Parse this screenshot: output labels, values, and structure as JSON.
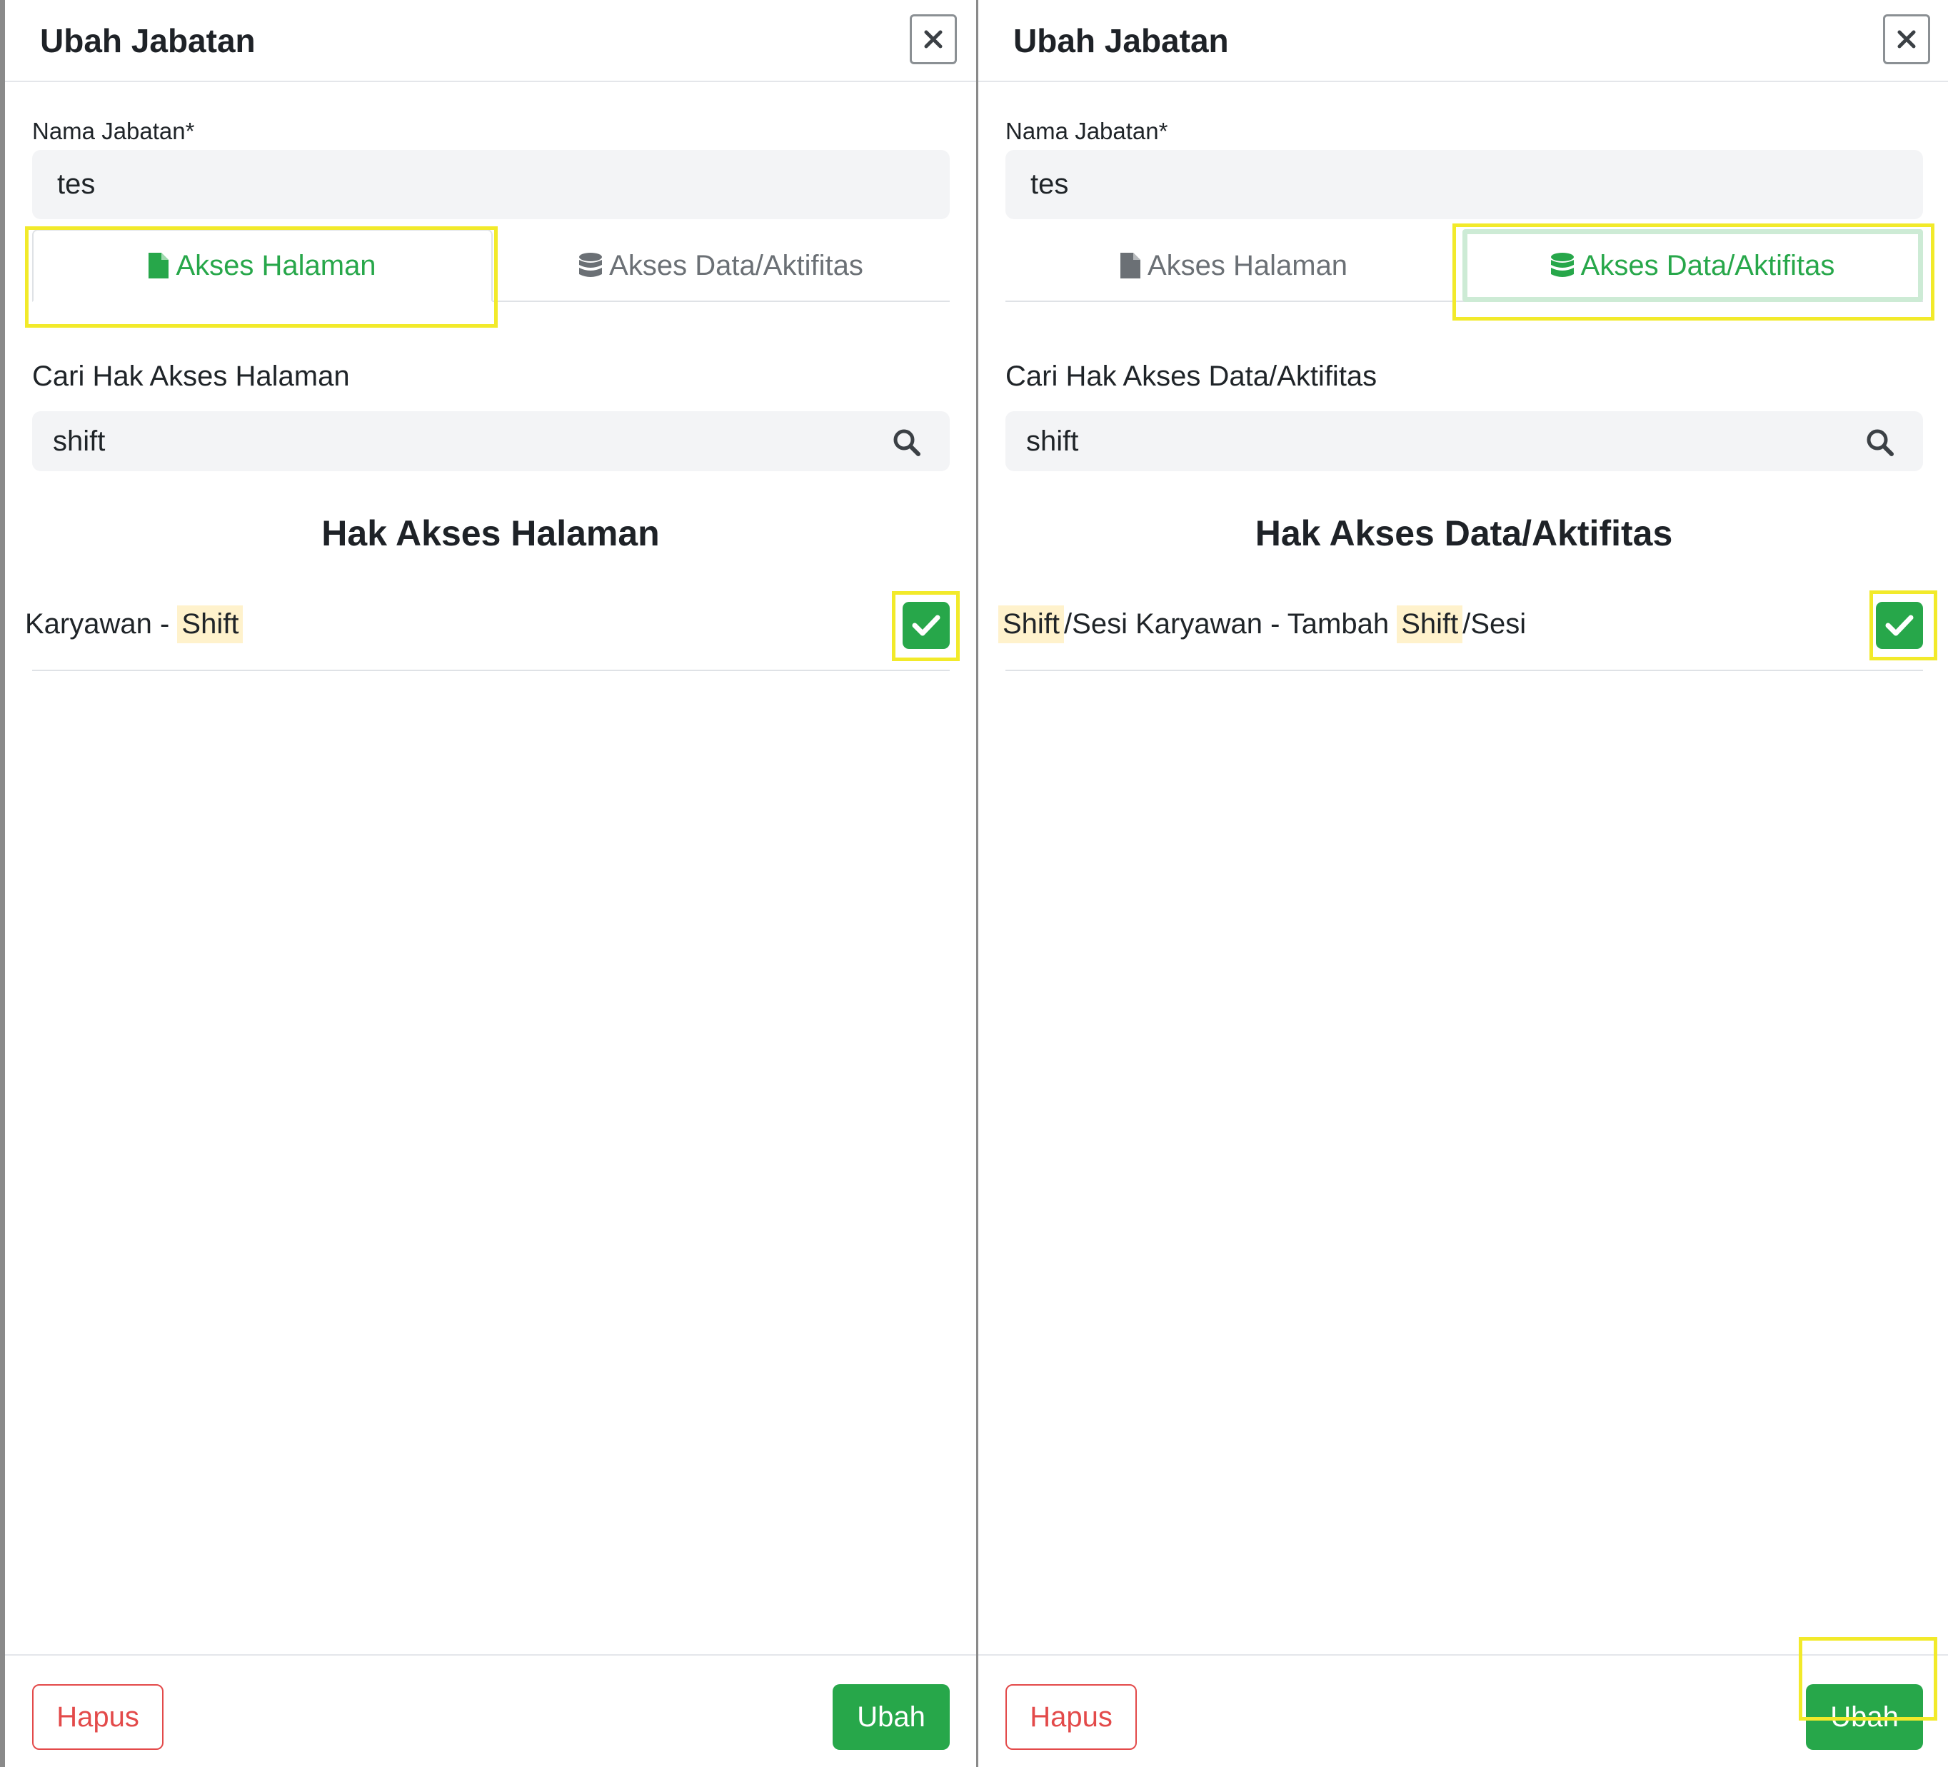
{
  "colors": {
    "accent_green": "#27a74a",
    "danger_red": "#e34a4a",
    "highlight_yellow": "#f2ea2a",
    "input_bg": "#f3f4f6",
    "mark_bg": "#fff2cc"
  },
  "panel_left": {
    "title": "Ubah Jabatan",
    "name_label": "Nama Jabatan*",
    "name_value": "tes",
    "tabs": [
      {
        "label": "Akses Halaman",
        "icon": "file-icon",
        "active": true
      },
      {
        "label": "Akses Data/Aktifitas",
        "icon": "database-icon",
        "active": false
      }
    ],
    "search_label": "Cari Hak Akses Halaman",
    "search_value": "shift",
    "section_title": "Hak Akses Halaman",
    "row": {
      "prefix": "Karyawan - ",
      "match": "Shift",
      "checked": true
    },
    "footer": {
      "delete_label": "Hapus",
      "submit_label": "Ubah"
    }
  },
  "panel_right": {
    "title": "Ubah Jabatan",
    "name_label": "Nama Jabatan*",
    "name_value": "tes",
    "tabs": [
      {
        "label": "Akses Halaman",
        "icon": "file-icon",
        "active": false
      },
      {
        "label": "Akses Data/Aktifitas",
        "icon": "database-icon",
        "active": true
      }
    ],
    "search_label": "Cari Hak Akses Data/Aktifitas",
    "search_value": "shift",
    "section_title": "Hak Akses Data/Aktifitas",
    "row": {
      "match1": "Shift",
      "middle": "/Sesi Karyawan - Tambah ",
      "match2": "Shift",
      "suffix": "/Sesi",
      "checked": true
    },
    "footer": {
      "delete_label": "Hapus",
      "submit_label": "Ubah"
    }
  }
}
